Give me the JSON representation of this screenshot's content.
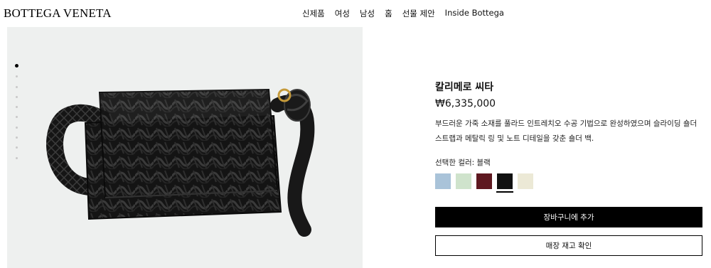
{
  "header": {
    "logo": "BOTTEGA VENETA",
    "nav": [
      {
        "label": "신제품"
      },
      {
        "label": "여성"
      },
      {
        "label": "남성"
      },
      {
        "label": "홈"
      },
      {
        "label": "선물 제안"
      },
      {
        "label": "Inside Bottega"
      }
    ]
  },
  "gallery": {
    "thumb_count": 10,
    "active_index": 0,
    "colors": {
      "background": "#eef0ef",
      "dot_active": "#000000",
      "dot": "#c9c9c9"
    }
  },
  "product": {
    "name": "칼리메로 씨타",
    "price": "₩6,335,000",
    "description": "부드러운 가죽 소재를 풀라드 인트레치오 수공 기법으로 완성하였으며 슬라이딩 숄더 스트랩과 메탈릭 링 및 노트 디테일을 갖춘 숄더 백.",
    "color_label": "선택한 컬러: 블랙",
    "swatches": [
      {
        "icon": "light-blue-swatch",
        "color": "#a9c3d9",
        "selected": false
      },
      {
        "icon": "mint-swatch",
        "color": "#cfe3cc",
        "selected": false
      },
      {
        "icon": "burgundy-swatch",
        "color": "#5e1820",
        "selected": false
      },
      {
        "icon": "black-swatch",
        "color": "#111111",
        "selected": true
      },
      {
        "icon": "cream-swatch",
        "color": "#ece9d6",
        "selected": false
      }
    ]
  },
  "actions": {
    "add_to_cart": "장바구니에 추가",
    "check_store": "매장 재고 확인"
  }
}
